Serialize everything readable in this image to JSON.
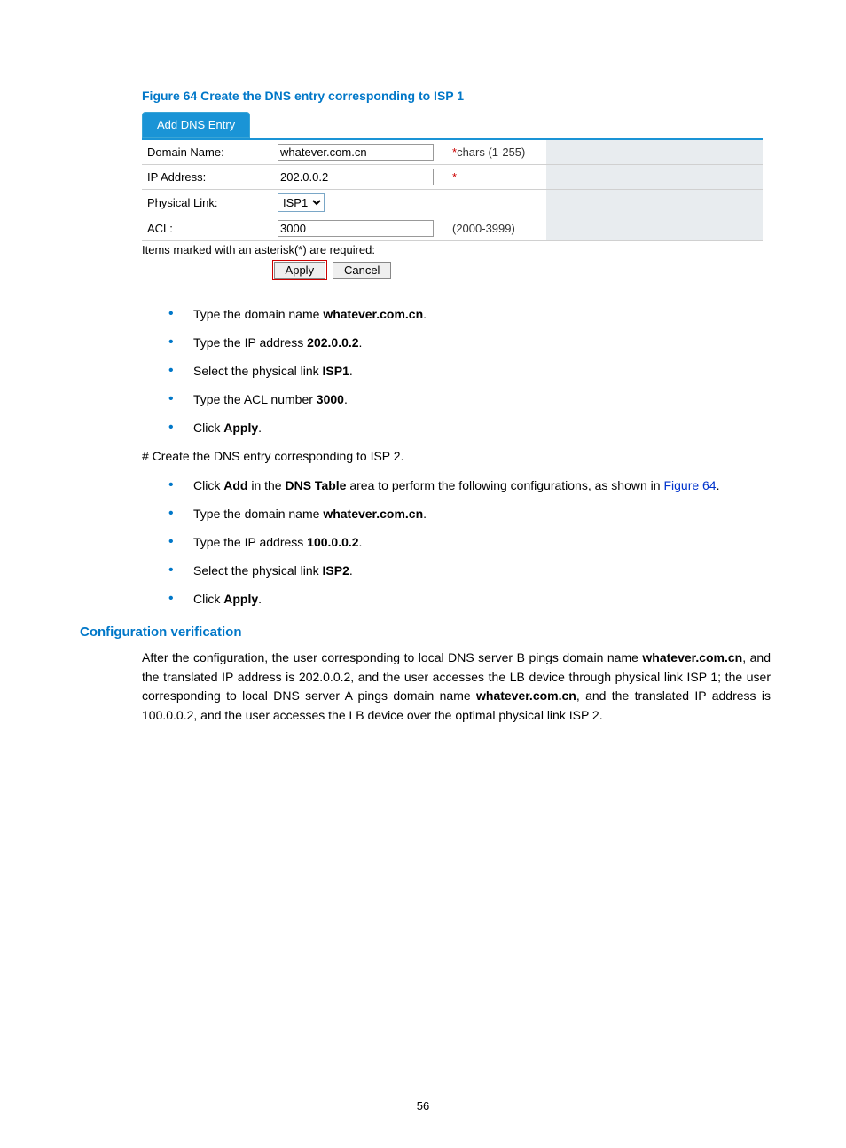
{
  "figure_caption": "Figure 64 Create the DNS entry corresponding to ISP 1",
  "panel": {
    "title": "Add DNS Entry",
    "rows": {
      "domain": {
        "label": "Domain Name:",
        "value": "whatever.com.cn",
        "hint": "chars (1-255)",
        "star": "*"
      },
      "ip": {
        "label": "IP Address:",
        "value": "202.0.0.2",
        "hint": "",
        "star": "*"
      },
      "link": {
        "label": "Physical Link:",
        "value": "ISP1"
      },
      "acl": {
        "label": "ACL:",
        "value": "3000",
        "hint": "(2000-3999)"
      }
    },
    "required_note": "Items marked with an asterisk(*) are required:",
    "apply": "Apply",
    "cancel": "Cancel"
  },
  "steps1": {
    "s1a": "Type the domain name ",
    "s1b": "whatever.com.cn",
    "s1c": ".",
    "s2a": "Type the IP address ",
    "s2b": "202.0.0.2",
    "s2c": ".",
    "s3a": "Select the physical link ",
    "s3b": "ISP1",
    "s3c": ".",
    "s4a": "Type the ACL number ",
    "s4b": "3000",
    "s4c": ".",
    "s5a": "Click ",
    "s5b": "Apply",
    "s5c": "."
  },
  "isp2_intro": "# Create the DNS entry corresponding to ISP 2.",
  "steps2": {
    "s0a": "Click ",
    "s0b": "Add",
    "s0c": " in the ",
    "s0d": "DNS Table",
    "s0e": " area to perform the following configurations, as shown in ",
    "s0link": "Figure 64",
    "s0f": ".",
    "s1a": "Type the domain name ",
    "s1b": "whatever.com.cn",
    "s1c": ".",
    "s2a": "Type the IP address ",
    "s2b": "100.0.0.2",
    "s2c": ".",
    "s3a": "Select the physical link ",
    "s3b": "ISP2",
    "s3c": ".",
    "s4a": "Click ",
    "s4b": "Apply",
    "s4c": "."
  },
  "verify_heading": "Configuration verification",
  "verify": {
    "t1": "After the configuration, the user corresponding to local DNS server B pings domain name ",
    "b1": "whatever.com.cn",
    "t2": ", and the translated IP address is 202.0.0.2, and the user accesses the LB device through physical link ISP 1; the user corresponding to local DNS server A pings domain name ",
    "b2": "whatever.com.cn",
    "t3": ", and the translated IP address is 100.0.0.2, and the user accesses the LB device over the optimal physical link ISP 2."
  },
  "page_number": "56"
}
